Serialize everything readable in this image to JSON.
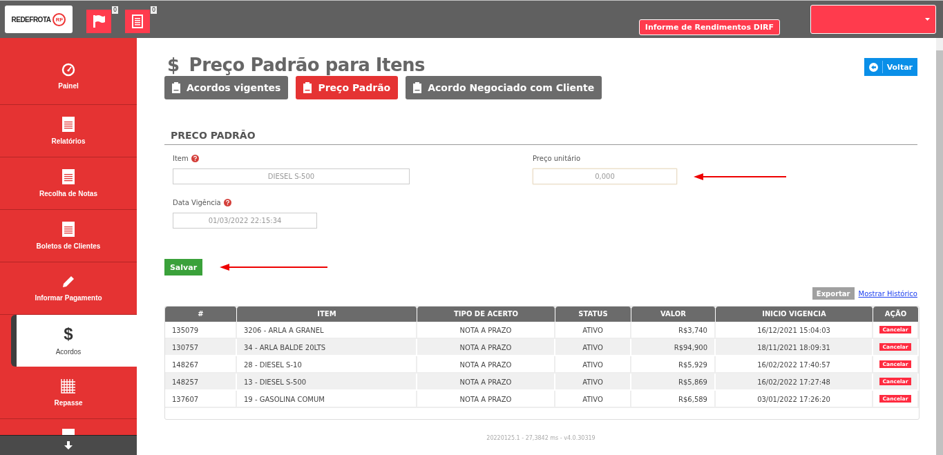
{
  "header": {
    "logo": {
      "text": "REDEFROTA",
      "mark": "RF"
    },
    "notifications": [
      {
        "kind": "flag",
        "count": "0"
      },
      {
        "kind": "document",
        "count": "0"
      }
    ],
    "dirf_button": "Informe de Rendimentos DIRF"
  },
  "sidebar": {
    "items": [
      {
        "label": "Painel",
        "kind": "gauge",
        "selected": false
      },
      {
        "label": "Relatórios",
        "kind": "document",
        "selected": false
      },
      {
        "label": "Recolha de Notas",
        "kind": "document",
        "selected": false
      },
      {
        "label": "Boletos de Clientes",
        "kind": "document",
        "selected": false
      },
      {
        "label": "Informar Pagamento",
        "kind": "pencil",
        "selected": false
      },
      {
        "label": "Acordos",
        "kind": "dollar",
        "selected": true
      },
      {
        "label": "Repasse",
        "kind": "grid",
        "selected": false
      }
    ]
  },
  "page": {
    "icon": "$",
    "title": "Preço Padrão para Itens",
    "back_button": "Voltar",
    "tabs": [
      {
        "label": "Acordos vigentes",
        "selected": false
      },
      {
        "label": "Preço Padrão",
        "selected": true
      },
      {
        "label": "Acordo Negociado com Cliente",
        "selected": false
      }
    ]
  },
  "form": {
    "section_title": "PRECO PADRÃO",
    "item": {
      "label": "Item",
      "value": "DIESEL S-500"
    },
    "date": {
      "label": "Data Vigência",
      "value": "01/03/2022 22:15:34"
    },
    "price": {
      "label": "Preço unitário",
      "placeholder": "0,000"
    },
    "save_button": "Salvar"
  },
  "table": {
    "export_button": "Exportar",
    "history_link": "Mostrar Histórico",
    "columns": [
      "#",
      "ITEM",
      "TIPO DE ACERTO",
      "STATUS",
      "VALOR",
      "INICIO VIGENCIA",
      "AÇÃO"
    ],
    "rows": [
      {
        "id": "135079",
        "item": "3206 - ARLA A GRANEL",
        "type": "NOTA A PRAZO",
        "status": "ATIVO",
        "value": "R$3,740",
        "start": "16/12/2021 15:04:03",
        "action": "Cancelar"
      },
      {
        "id": "130757",
        "item": "34 - ARLA BALDE 20LTS",
        "type": "NOTA A PRAZO",
        "status": "ATIVO",
        "value": "R$94,900",
        "start": "18/11/2021 18:09:31",
        "action": "Cancelar"
      },
      {
        "id": "148267",
        "item": "28 - DIESEL S-10",
        "type": "NOTA A PRAZO",
        "status": "ATIVO",
        "value": "R$5,929",
        "start": "16/02/2022 17:40:57",
        "action": "Cancelar"
      },
      {
        "id": "148257",
        "item": "13 - DIESEL S-500",
        "type": "NOTA A PRAZO",
        "status": "ATIVO",
        "value": "R$5,869",
        "start": "16/02/2022 17:27:48",
        "action": "Cancelar"
      },
      {
        "id": "137607",
        "item": "19 - GASOLINA COMUM",
        "type": "NOTA A PRAZO",
        "status": "ATIVO",
        "value": "R$6,589",
        "start": "03/01/2022 17:26:20",
        "action": "Cancelar"
      }
    ]
  },
  "footer": "20220125.1 - 27,3842 ms - v4.0.30319"
}
